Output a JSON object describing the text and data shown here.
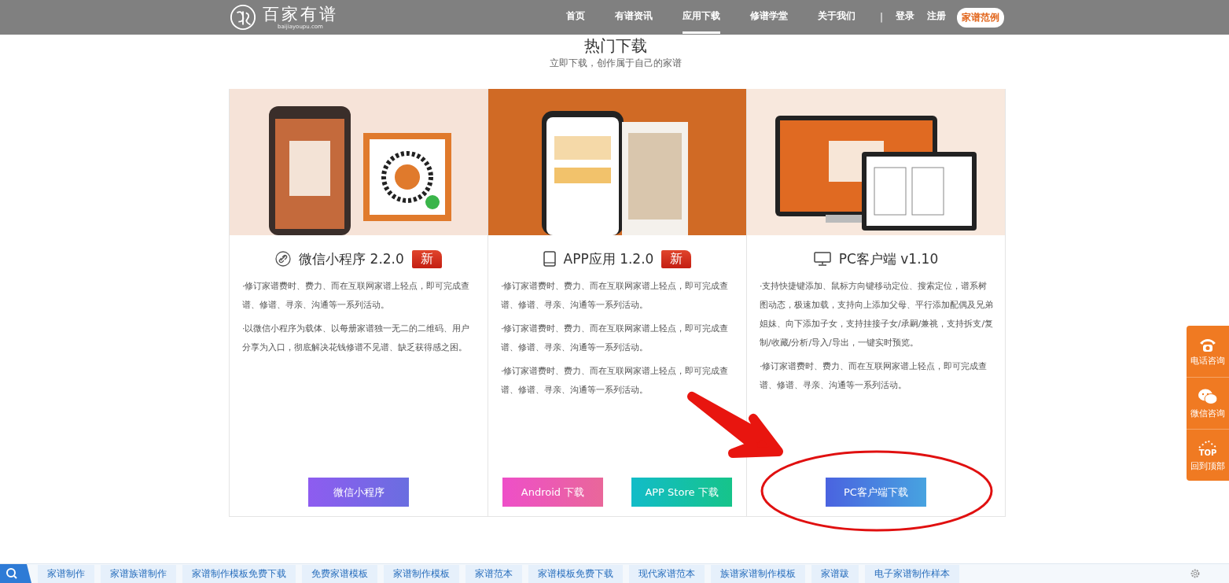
{
  "header": {
    "logo": {
      "name": "百家有谱",
      "domain": "baijiayoupu.com"
    },
    "nav": [
      {
        "label": "首页",
        "selected": false
      },
      {
        "label": "有谱资讯",
        "selected": false
      },
      {
        "label": "应用下载",
        "selected": true
      },
      {
        "label": "修谱学堂",
        "selected": false
      },
      {
        "label": "关于我们",
        "selected": false
      }
    ],
    "separator": "|",
    "login": "登录",
    "register": "注册",
    "cta": "家谱范例"
  },
  "section": {
    "title": "热门下载",
    "subtitle": "立即下载，创作属于自己的家谱"
  },
  "cards": [
    {
      "kind": "miniprogram",
      "title": "微信小程序 2.2.0",
      "badge": "新",
      "paragraphs": [
        "·修订家谱费时、费力、而在互联网家谱上轻点，即可完成查谱、修谱、寻亲、沟通等一系列活动。",
        "·以微信小程序为载体、以每册家谱独一无二的二维码、用户分享为入口，彻底解决花钱修谱不见谱、缺乏获得感之困。"
      ],
      "buttons": [
        {
          "label": "微信小程序",
          "kind": "purple"
        }
      ]
    },
    {
      "kind": "app",
      "title": "APP应用 1.2.0",
      "badge": "新",
      "paragraphs": [
        "·修订家谱费时、费力、而在互联网家谱上轻点，即可完成查谱、修谱、寻亲、沟通等一系列活动。",
        "·修订家谱费时、费力、而在互联网家谱上轻点，即可完成查谱、修谱、寻亲、沟通等一系列活动。",
        "·修订家谱费时、费力、而在互联网家谱上轻点，即可完成查谱、修谱、寻亲、沟通等一系列活动。"
      ],
      "buttons": [
        {
          "label": "Android 下载",
          "kind": "pink"
        },
        {
          "label": "APP Store 下载",
          "kind": "teal"
        }
      ]
    },
    {
      "kind": "pc",
      "title": "PC客户端 v1.10",
      "paragraphs": [
        "·支持快捷键添加、鼠标方向键移动定位、搜索定位，谱系树图动态，极速加载，支持向上添加父母、平行添加配偶及兄弟姐妹、向下添加子女，支持挂接子女/承嗣/兼祧，支持拆支/复制/收藏/分析/导入/导出，一键实时预览。",
        "·修订家谱费时、费力、而在互联网家谱上轻点，即可完成查谱、修谱、寻亲、沟通等一系列活动。"
      ],
      "buttons": [
        {
          "label": "PC客户端下载",
          "kind": "blue"
        }
      ]
    }
  ],
  "side_panel": [
    {
      "kind": "phone",
      "label": "电话咨询"
    },
    {
      "kind": "wechat",
      "label": "微信咨询"
    },
    {
      "kind": "top",
      "icon_text": "TOP",
      "label": "回到顶部"
    }
  ],
  "bottom_bar": {
    "tags": [
      "家谱制作",
      "家谱族谱制作",
      "家谱制作模板免费下载",
      "免费家谱模板",
      "家谱制作模板",
      "家谱范本",
      "家谱模板免费下载",
      "现代家谱范本",
      "族谱家谱制作模板",
      "家谱跋",
      "电子家谱制作样本"
    ]
  }
}
